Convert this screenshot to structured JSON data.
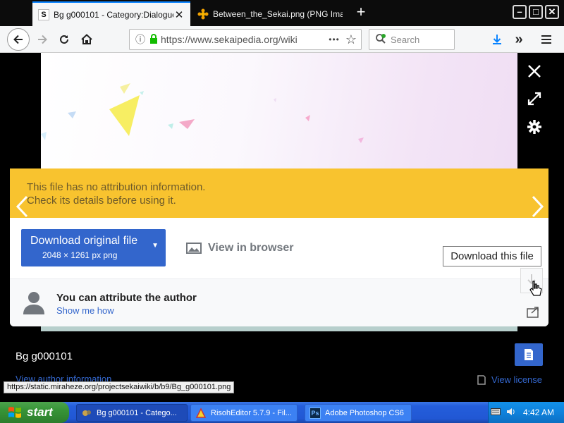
{
  "browser": {
    "tabs": [
      {
        "title": "Bg g000101 - Category:Dialogue",
        "favicon": "S",
        "active": true
      },
      {
        "title": "Between_the_Sekai.png (PNG Image,",
        "active": false
      }
    ],
    "url": "https://www.sekaipedia.org/wiki",
    "search_placeholder": "Search",
    "url_more": "•••"
  },
  "viewer": {
    "attribution_warning_line1": "This file has no attribution information.",
    "attribution_warning_line2": "Check its details before using it.",
    "download_button_label": "Download original file",
    "download_button_sub": "2048 × 1261 px png",
    "view_in_browser": "View in browser",
    "tooltip": "Download this file",
    "attrib_title": "You can attribute the author",
    "attrib_link": "Show me how",
    "file_title": "Bg g000101",
    "view_license": "View license",
    "author_info": "View author information"
  },
  "status_url": "https://static.miraheze.org/projectsekaiwiki/b/b9/Bg_g000101.png",
  "taskbar": {
    "start": "start",
    "items": [
      {
        "label": "Bg g000101 - Catego...",
        "active": true
      },
      {
        "label": "RisohEditor 5.7.9 - Fil...",
        "active": false
      },
      {
        "label": "Adobe Photoshop CS6",
        "active": false
      }
    ],
    "clock": "4:42 AM"
  },
  "colors": {
    "accent": "#3366cc",
    "warning_banner": "#f8c32f",
    "xp_taskbar": "#245edb"
  }
}
